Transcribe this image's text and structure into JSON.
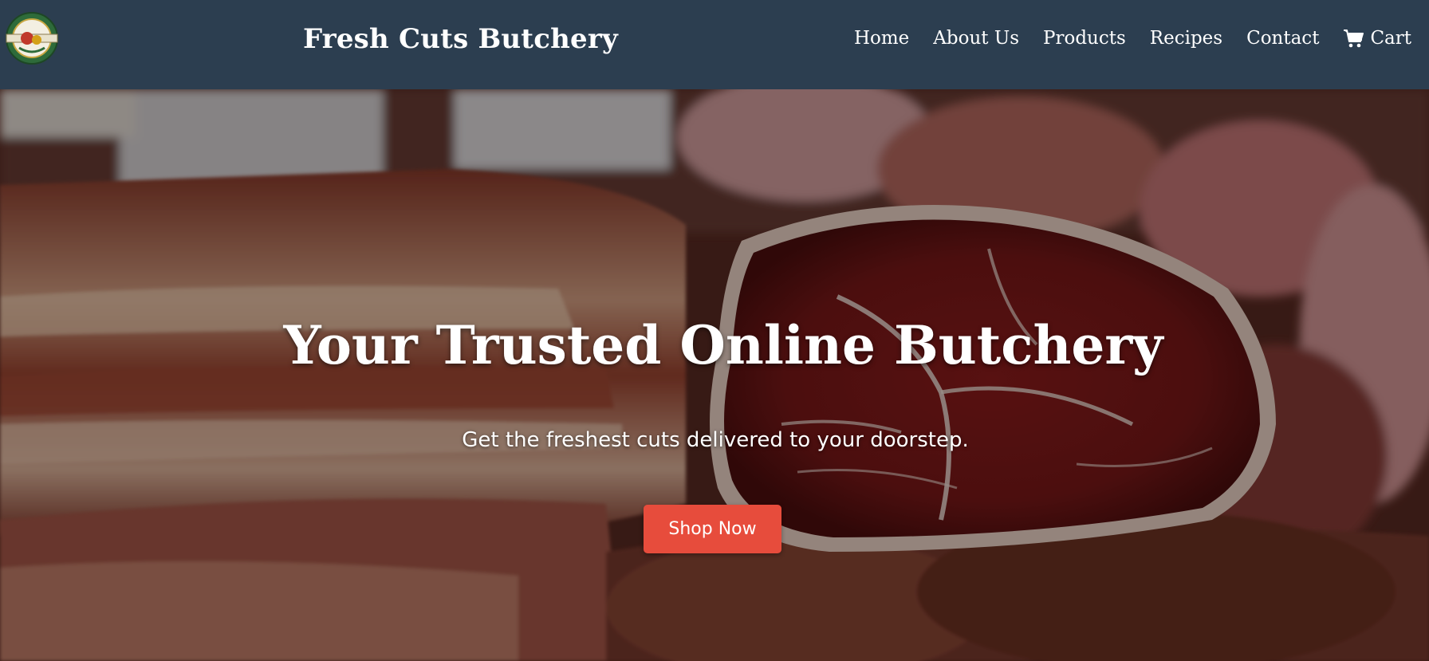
{
  "header": {
    "logo_icon": "butchery-badge-logo",
    "brand_name": "Fresh Cuts Butchery",
    "nav": [
      {
        "label": "Home"
      },
      {
        "label": "About Us"
      },
      {
        "label": "Products"
      },
      {
        "label": "Recipes"
      },
      {
        "label": "Contact"
      },
      {
        "label": "Cart",
        "icon": "cart-icon"
      }
    ]
  },
  "hero": {
    "title": "Your Trusted Online Butchery",
    "subtitle": "Get the freshest cuts delivered to your doorstep.",
    "cta_label": "Shop Now",
    "background_image": "meat-display-photo"
  },
  "colors": {
    "navbar_bg": "#2c3e50",
    "cta_bg": "#e74c3c",
    "text": "#ffffff"
  }
}
